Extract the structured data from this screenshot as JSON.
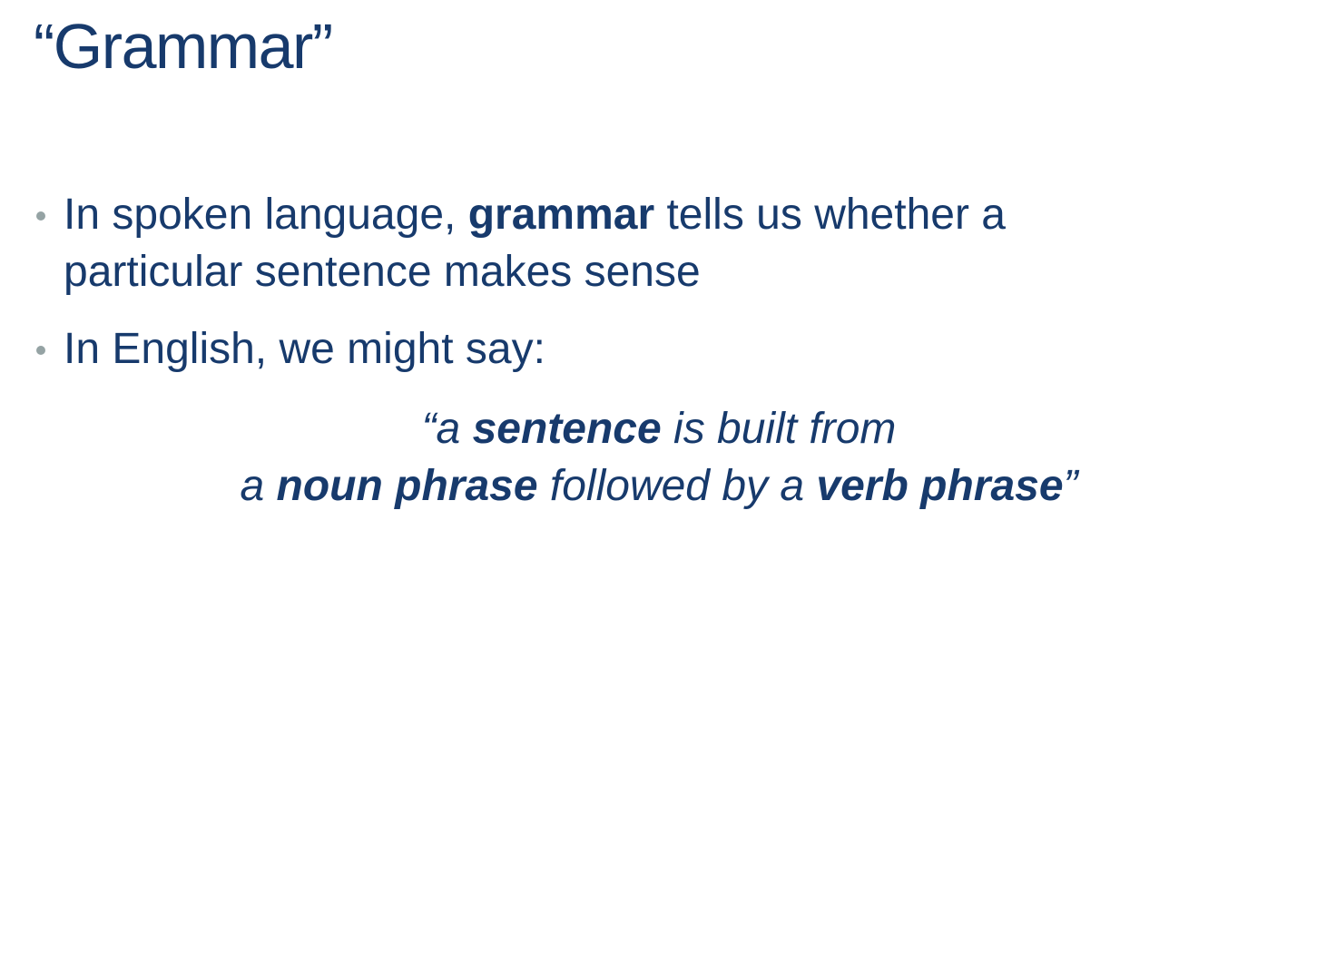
{
  "slide": {
    "title": "“Grammar”",
    "bullets": [
      {
        "before": "In spoken language, ",
        "bold": "grammar",
        "after": " tells us whether a",
        "line2": "particular sentence makes sense"
      },
      {
        "text": "In English, we might say:"
      }
    ],
    "quote": {
      "line1": {
        "open": "“a ",
        "bold": "sentence",
        "rest": " is built from"
      },
      "line2": {
        "pre": "a ",
        "bold1": "noun phrase",
        "mid": " followed by a ",
        "bold2": "verb phrase",
        "close": "”"
      }
    }
  },
  "colors": {
    "text": "#173a6c",
    "bullet": "#95a3a4",
    "background": "#ffffff"
  }
}
